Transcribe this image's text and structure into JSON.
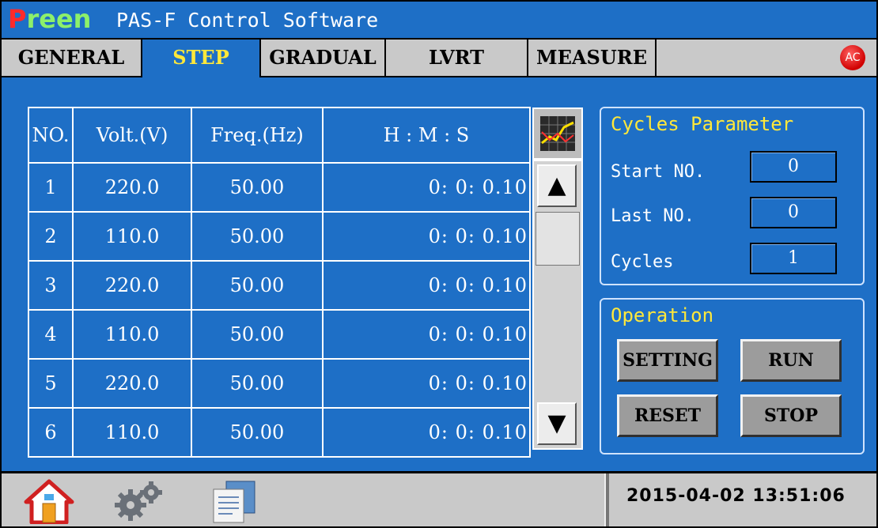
{
  "app": {
    "brand": "Preen",
    "title": "PAS-F Control Software"
  },
  "tabs": [
    {
      "label": "GENERAL",
      "active": false
    },
    {
      "label": "STEP",
      "active": true
    },
    {
      "label": "GRADUAL",
      "active": false
    },
    {
      "label": "LVRT",
      "active": false
    },
    {
      "label": "MEASURE",
      "active": false
    }
  ],
  "indicator": {
    "label": "AC",
    "color": "#e00000"
  },
  "step_table": {
    "headers": [
      "NO.",
      "Volt.(V)",
      "Freq.(Hz)",
      "H : M : S"
    ],
    "rows": [
      {
        "no": "1",
        "volt": "220.0",
        "freq": "50.00",
        "time": "0:  0:  0.10"
      },
      {
        "no": "2",
        "volt": "110.0",
        "freq": "50.00",
        "time": "0:  0:  0.10"
      },
      {
        "no": "3",
        "volt": "220.0",
        "freq": "50.00",
        "time": "0:  0:  0.10"
      },
      {
        "no": "4",
        "volt": "110.0",
        "freq": "50.00",
        "time": "0:  0:  0.10"
      },
      {
        "no": "5",
        "volt": "220.0",
        "freq": "50.00",
        "time": "0:  0:  0.10"
      },
      {
        "no": "6",
        "volt": "110.0",
        "freq": "50.00",
        "time": "0:  0:  0.10"
      }
    ]
  },
  "icons": {
    "chart": "chart-icon",
    "scroll_up": "up-arrow-icon",
    "scroll_down": "down-arrow-icon",
    "home": "home-icon",
    "settings": "gears-icon",
    "files": "files-icon"
  },
  "cycles": {
    "title": "Cycles Parameter",
    "start_label": "Start NO.",
    "start_value": "0",
    "last_label": "Last NO.",
    "last_value": "0",
    "cycles_label": "Cycles",
    "cycles_value": "1"
  },
  "operation": {
    "title": "Operation",
    "setting": "SETTING",
    "run": "RUN",
    "reset": "RESET",
    "stop": "STOP"
  },
  "status": {
    "datetime": "2015-04-02 13:51:06"
  },
  "colors": {
    "background": "#1e6fc6",
    "tab_bar": "#c9c9c9",
    "active_tab_text": "#ffe83a",
    "panel_title": "#ffe83a"
  }
}
